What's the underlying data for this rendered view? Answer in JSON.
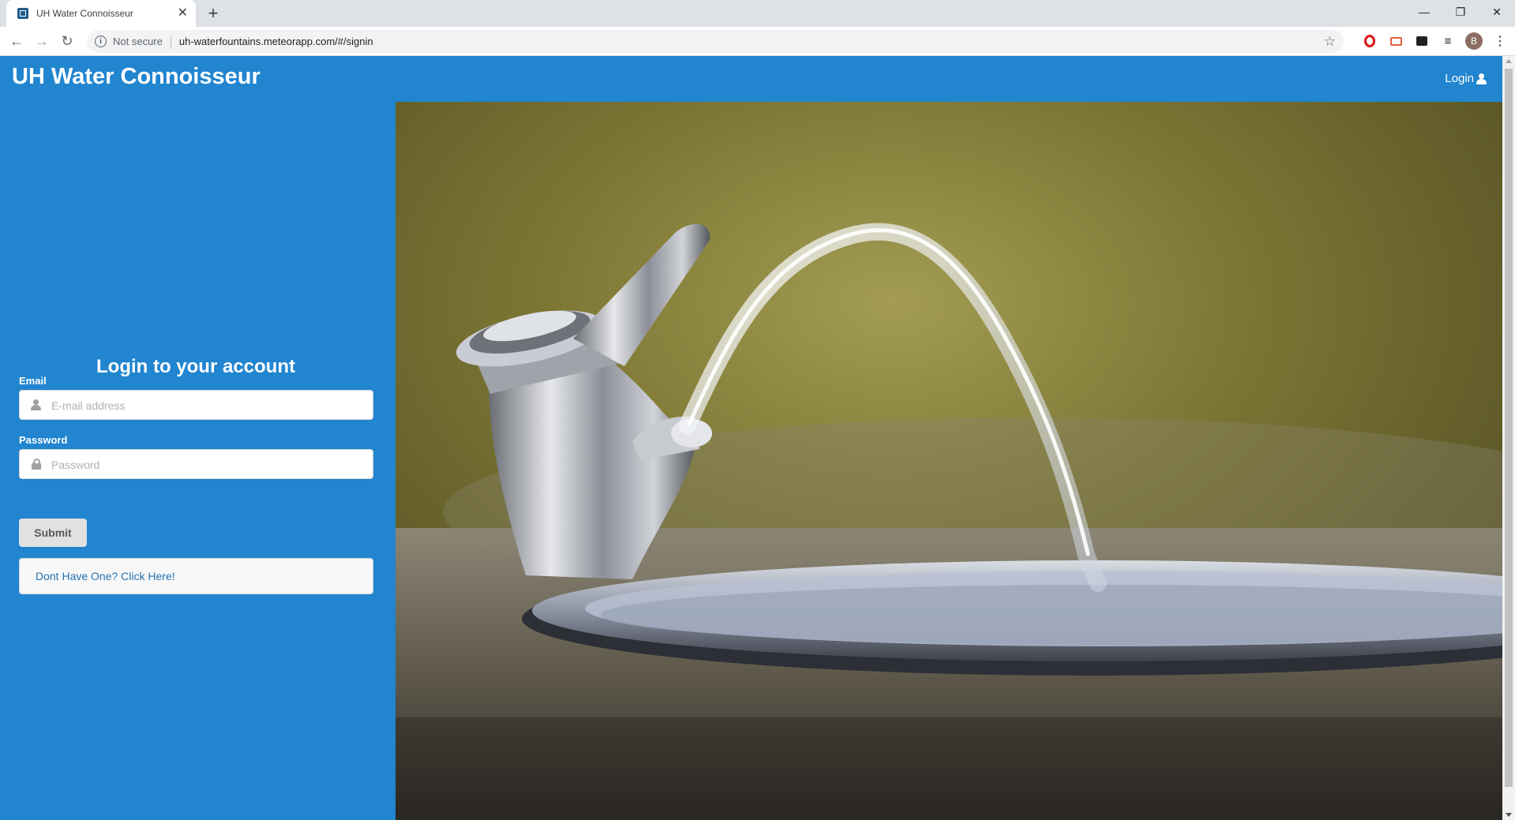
{
  "browser": {
    "tab_title": "UH Water Connoisseur",
    "tab_close": "✕",
    "new_tab": "+",
    "window_controls": {
      "minimize": "—",
      "restore": "❐",
      "close": "✕"
    },
    "back_glyph": "←",
    "forward_glyph": "→",
    "reload_glyph": "↻",
    "security_label": "Not secure",
    "url": "uh-waterfountains.meteorapp.com/#/signin",
    "bookmark_glyph": "☆",
    "profile_initial": "B",
    "menu_glyph": "⋮",
    "list_glyph": "≡"
  },
  "navbar": {
    "brand": "UH Water Connoisseur",
    "login_label": "Login",
    "color": "#2185d0"
  },
  "signin": {
    "title": "Login to your account",
    "email_label": "Email",
    "email_placeholder": "E-mail address",
    "email_value": "",
    "password_label": "Password",
    "password_placeholder": "Password",
    "password_value": "",
    "submit_label": "Submit",
    "register_link": "Dont Have One? Click Here!"
  },
  "hero": {
    "subject": "drinking-fountain-photo"
  }
}
